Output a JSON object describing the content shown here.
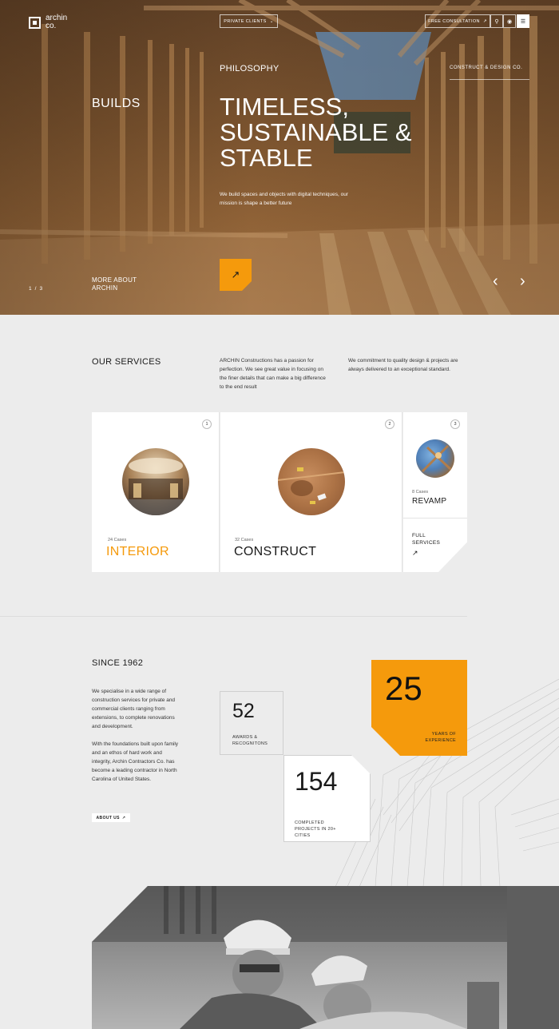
{
  "nav": {
    "logo_text": "archin co.",
    "private_clients": "PRIVATE CLIENTS",
    "free_consultation": "FREE CONSULTATION",
    "icons": [
      "search-icon",
      "globe-icon",
      "menu-icon"
    ]
  },
  "hero": {
    "philosophy": "PHILOSOPHY",
    "tagline": "CONSTRUCT & DESIGN CO.",
    "builds": "BUILDS",
    "title_lines": [
      "TIMELESS,",
      "SUSTAINABLE &",
      "STABLE"
    ],
    "subtitle": "We build spaces and objects with digital techniques, our mission is shape a better future",
    "more_about": "MORE ABOUT ARCHIN",
    "pager_current": "1",
    "pager_sep": "/",
    "pager_total": "3",
    "accent": "#f59a0c"
  },
  "services": {
    "heading": "OUR SERVICES",
    "para1": "ARCHIN Constructions has a passion for perfection. We see great value in focusing on the finer details that can make a big difference to the end result",
    "para2": "We commitment to quality design & projects are always delivered to an exceptional standard.",
    "cards": [
      {
        "num": "1",
        "cases": "24 Cases",
        "label": "INTERIOR"
      },
      {
        "num": "2",
        "cases": "32 Cases",
        "label": "CONSTRUCT"
      },
      {
        "num": "3",
        "cases": "8 Cases",
        "label": "REVAMP"
      }
    ],
    "full_services": "FULL SERVICES"
  },
  "since": {
    "heading": "SINCE 1962",
    "para1": "We specialise in a wide range of construction services for private and commercial clients ranging from extensions, to complete renovations and development.",
    "para2": "With the foundations built upon family and an ethos of hard work and integrity, Archin Contractors Co. has become a leading contractor in North Carolina of United States.",
    "about_button": "ABOUT US",
    "stats": [
      {
        "value": "52",
        "label": "AWARDS & RECOGNITONS"
      },
      {
        "value": "154",
        "label": "COMPLETED PROJECTS IN 20+ CITIES"
      },
      {
        "value": "25",
        "label": "YEARS OF EXPERIENCE"
      }
    ]
  }
}
